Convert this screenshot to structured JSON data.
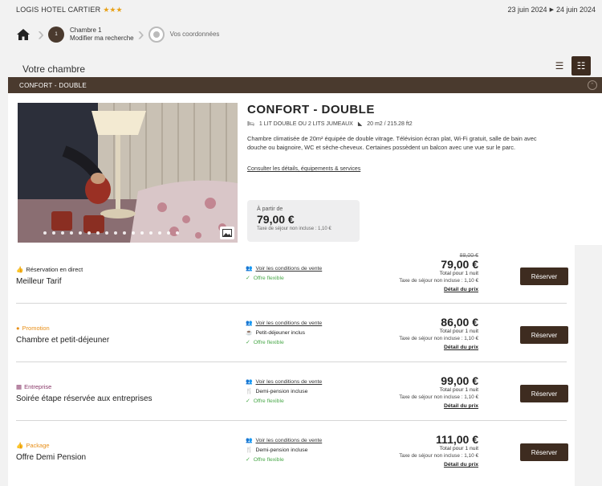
{
  "topbar": {
    "hotel_name": "LOGIS HOTEL CARTIER",
    "stars": "★★★",
    "date_from": "23 juin 2024",
    "date_to": "24 juin 2024",
    "date_arrow": "▶"
  },
  "steps": {
    "home_icon": "home-icon",
    "step1_circle": "1",
    "step1_line1": "Chambre 1",
    "step1_line2": "Modifier ma recherche",
    "step2_line1": "Vos coordonnées"
  },
  "room_section": {
    "title": "Votre chambre",
    "view_list_icon": "☰",
    "view_grid_icon": "☷"
  },
  "room": {
    "bar_label": "CONFORT - DOUBLE",
    "name": "CONFORT - DOUBLE",
    "beds": "1 LIT DOUBLE OU 2 LITS JUMEAUX",
    "area": "20 m2 / 215.28 ft2",
    "description": "Chambre climatisée de 20m² équipée de double vitrage. Télévision écran plat, Wi-Fi gratuit, salle de bain avec douche ou baignoire, WC et sèche-cheveux. Certaines possèdent un balcon avec une vue sur le parc.",
    "link": "Consulter les détails, équipements & services",
    "price_from_label": "À partir de",
    "price_from": "79,00 €",
    "price_tax": "Taxe de séjour non incluse : 1,10 €"
  },
  "rates": [
    {
      "tag_icon": "👍",
      "tag": "Réservation en direct",
      "tag_color": "#222222",
      "name": "Meilleur Tarif",
      "conditions": [
        {
          "icon": "👥",
          "text": "Voir les conditions de vente",
          "type": "link"
        },
        {
          "icon": "✓",
          "text": "Offre flexible",
          "type": "flex"
        }
      ],
      "old_price": "88,00 €",
      "price": "79,00 €",
      "total": "Total pour 1 nuit",
      "tax": "Taxe de séjour non incluse : 1,10 €",
      "detail": "Détail du prix",
      "button": "Réserver"
    },
    {
      "tag_icon": "●",
      "tag": "Promotion",
      "tag_color": "#e8901a",
      "name": "Chambre et petit-déjeuner",
      "conditions": [
        {
          "icon": "👥",
          "text": "Voir les conditions de vente",
          "type": "link"
        },
        {
          "icon": "☕",
          "text": "Petit-déjeuner inclus",
          "type": "plain"
        },
        {
          "icon": "✓",
          "text": "Offre flexible",
          "type": "flex"
        }
      ],
      "old_price": "",
      "price": "86,00 €",
      "total": "Total pour 1 nuit",
      "tax": "Taxe de séjour non incluse : 1,10 €",
      "detail": "Détail du prix",
      "button": "Réserver"
    },
    {
      "tag_icon": "▦",
      "tag": "Entreprise",
      "tag_color": "#8a3a6a",
      "name": "Soirée étape réservée aux entreprises",
      "conditions": [
        {
          "icon": "👥",
          "text": "Voir les conditions de vente",
          "type": "link"
        },
        {
          "icon": "🍴",
          "text": "Demi-pension incluse",
          "type": "plain"
        },
        {
          "icon": "✓",
          "text": "Offre flexible",
          "type": "flex"
        }
      ],
      "old_price": "",
      "price": "99,00 €",
      "total": "Total pour 1 nuit",
      "tax": "Taxe de séjour non incluse : 1,10 €",
      "detail": "Détail du prix",
      "button": "Réserver"
    },
    {
      "tag_icon": "👍",
      "tag": "Package",
      "tag_color": "#e8901a",
      "name": "Offre Demi Pension",
      "conditions": [
        {
          "icon": "👥",
          "text": "Voir les conditions de vente",
          "type": "link"
        },
        {
          "icon": "🍴",
          "text": "Demi-pension incluse",
          "type": "plain"
        },
        {
          "icon": "✓",
          "text": "Offre flexible",
          "type": "flex"
        }
      ],
      "old_price": "",
      "price": "111,00 €",
      "total": "Total pour 1 nuit",
      "tax": "Taxe de séjour non incluse : 1,10 €",
      "detail": "Détail du prix",
      "button": "Réserver"
    }
  ],
  "colors": {
    "brand_brown": "#3e2c20",
    "flexible_green": "#4aa84a",
    "star_gold": "#e8a21a"
  }
}
